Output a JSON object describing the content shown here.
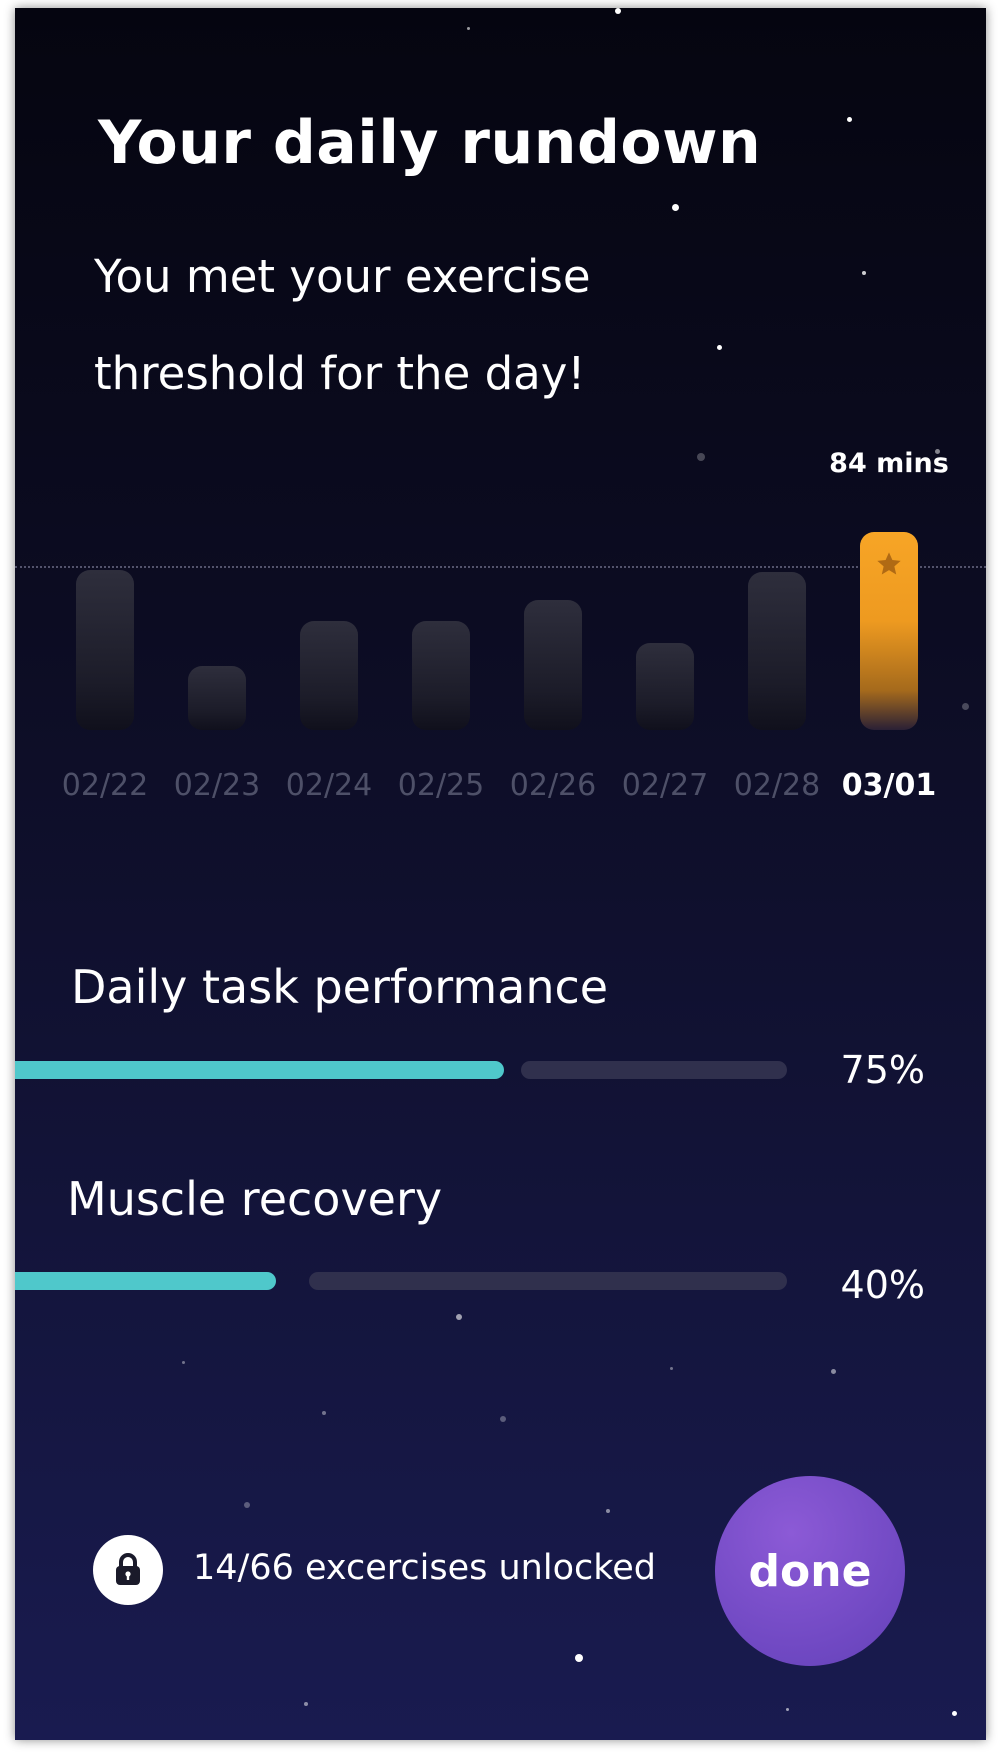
{
  "header": {
    "title": "Your daily rundown",
    "message": "You met your exercise threshold for the day!"
  },
  "chart_data": {
    "type": "bar",
    "categories": [
      "02/22",
      "02/23",
      "02/24",
      "02/25",
      "02/26",
      "02/27",
      "02/28",
      "03/01"
    ],
    "values": [
      68,
      27,
      46,
      46,
      55,
      37,
      67,
      84
    ],
    "highlight_index": 7,
    "highlight_label": "84 mins",
    "threshold": 68,
    "ylim": [
      0,
      90
    ],
    "bar_color": "#2a2a38",
    "highlight_color": "#f7a526",
    "highlight_icon": "star-icon",
    "grid": false
  },
  "metrics": [
    {
      "label": "Daily task performance",
      "value_text": "75%",
      "fraction": 0.75
    },
    {
      "label": "Muscle recovery",
      "value_text": "40%",
      "fraction": 0.4
    }
  ],
  "footer": {
    "lock_icon": "lock-icon",
    "unlocked_text": "14/66 excercises unlocked",
    "done_label": "done"
  },
  "colors": {
    "accent_teal": "#4fc8cb",
    "accent_orange": "#f7a526",
    "button_purple": "#7a4fcc",
    "track": "#30304d"
  }
}
